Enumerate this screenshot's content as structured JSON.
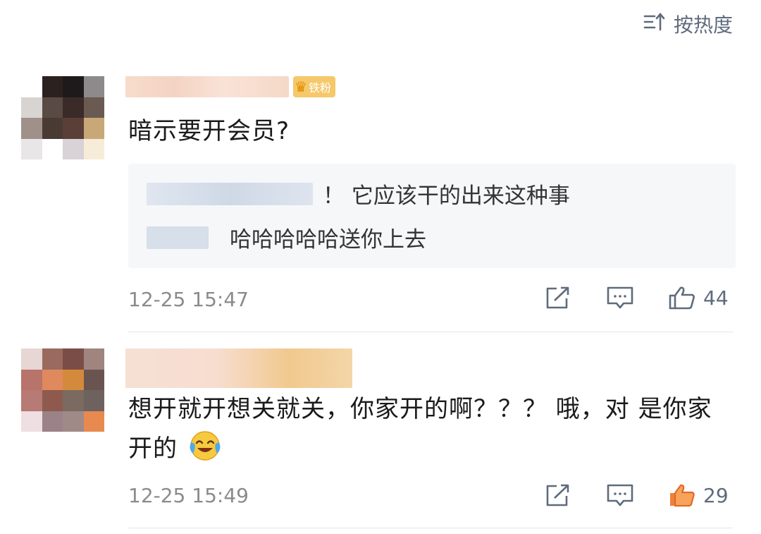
{
  "sort_label": "按热度",
  "comments": [
    {
      "fan_badge": "铁粉",
      "text": "暗示要开会员?",
      "quote": [
        {
          "text": "！ 它应该干的出来这种事"
        },
        {
          "text": "哈哈哈哈哈送你上去"
        }
      ],
      "time": "12-25 15:47",
      "likes": "44",
      "liked": false
    },
    {
      "text": "想开就开想关就关，你家开的啊？？？ 哦，对 是你家开的",
      "time": "12-25 15:49",
      "likes": "29",
      "liked": true
    }
  ],
  "colors": {
    "meta": "#8b8b8b",
    "icon": "#5f6b7d",
    "liked": "#f0803c",
    "quote_bg": "#f6f7f9"
  },
  "icons": {
    "sort": "sort-icon",
    "share": "share-icon",
    "reply": "comment-icon",
    "like": "thumbs-up-icon",
    "emoji": "laughing-crying-emoji"
  }
}
